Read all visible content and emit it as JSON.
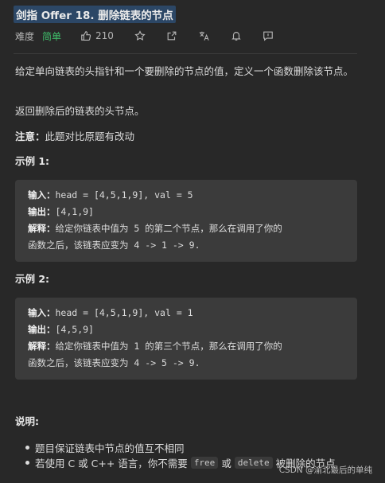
{
  "title": "剑指 Offer 18. 删除链表的节点",
  "meta": {
    "difficulty_label": "难度",
    "difficulty": "简单",
    "likes": "210"
  },
  "description": [
    "给定单向链表的头指针和一个要删除的节点的值，定义一个函数删除该节点。",
    "返回删除后的链表的头节点。"
  ],
  "note": {
    "label": "注意：",
    "text": "此题对比原题有改动"
  },
  "examples": [
    {
      "heading": "示例 1:",
      "input_label": "输入：",
      "input": "head = [4,5,1,9], val = 5",
      "output_label": "输出：",
      "output": "[4,1,9]",
      "explain_label": "解释：",
      "explain_1": "给定你链表中值为 5 的第二个节点，那么在调用了你的",
      "explain_2": "函数之后，该链表应变为 4 -> 1 -> 9."
    },
    {
      "heading": "示例 2:",
      "input_label": "输入：",
      "input": "head = [4,5,1,9], val = 1",
      "output_label": "输出：",
      "output": "[4,5,9]",
      "explain_label": "解释：",
      "explain_1": "给定你链表中值为 1 的第三个节点，那么在调用了你的",
      "explain_2": "函数之后，该链表应变为 4 -> 5 -> 9."
    }
  ],
  "notes": {
    "heading": "说明:",
    "item1": "题目保证链表中节点的值互不相同",
    "item2_a": "若使用 C 或 C++ 语言，你不需要",
    "item2_code1": "free",
    "item2_b": "或",
    "item2_code2": "delete",
    "item2_c": "被删除的节点"
  },
  "watermark": "CSDN @渝北最后的单纯"
}
